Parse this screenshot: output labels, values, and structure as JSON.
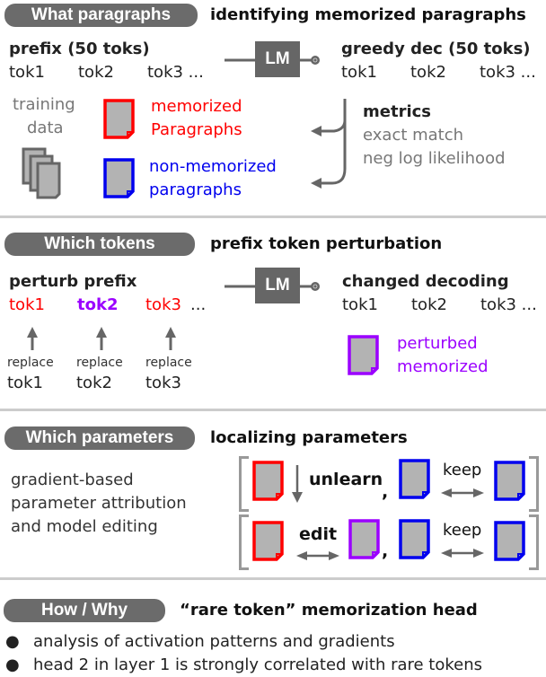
{
  "sections": {
    "what": {
      "pill": "What paragraphs",
      "heading": "identifying memorized paragraphs",
      "prefix_label": "prefix (50 toks)",
      "prefix_tokens": [
        "tok1",
        "tok2",
        "tok3 ..."
      ],
      "lm_label": "LM",
      "output_label": "greedy dec (50 toks)",
      "output_tokens": [
        "tok1",
        "tok2",
        "tok3 ..."
      ],
      "training_data_label": [
        "training",
        "data"
      ],
      "memorized_label": [
        "memorized",
        "Paragraphs"
      ],
      "non_memorized_label": [
        "non-memorized",
        "paragraphs"
      ],
      "metrics_title": "metrics",
      "metrics_items": [
        "exact match",
        "neg log likelihood"
      ]
    },
    "tokens": {
      "pill": "Which tokens",
      "heading": "prefix token perturbation",
      "prefix_label": "perturb prefix",
      "prefix_tokens": [
        "tok1",
        "tok2",
        "tok3",
        "..."
      ],
      "lm_label": "LM",
      "output_label": "changed decoding",
      "output_tokens": [
        "tok1",
        "tok2",
        "tok3 ..."
      ],
      "replace_label": "replace",
      "replace_tokens": [
        "tok1",
        "tok2",
        "tok3"
      ],
      "perturbed_label": [
        "perturbed",
        "memorized"
      ]
    },
    "params": {
      "pill": "Which parameters",
      "heading": "localizing parameters",
      "description": [
        "gradient-based",
        "parameter attribution",
        "and model editing"
      ],
      "unlearn_label": "unlearn",
      "edit_label": "edit",
      "keep_label": "keep",
      "comma": ","
    },
    "how": {
      "pill": "How / Why",
      "heading": "“rare token” memorization head",
      "bullets": [
        "analysis of activation patterns and gradients",
        "head 2 in layer 1 is strongly correlated with rare tokens"
      ]
    }
  },
  "colors": {
    "memorized": "#ff0000",
    "non_memorized": "#0000ee",
    "perturbed": "#9b00ff",
    "pill": "#6b6b6b",
    "doc_fill": "#b3b3b3",
    "divider": "#cccccc"
  }
}
